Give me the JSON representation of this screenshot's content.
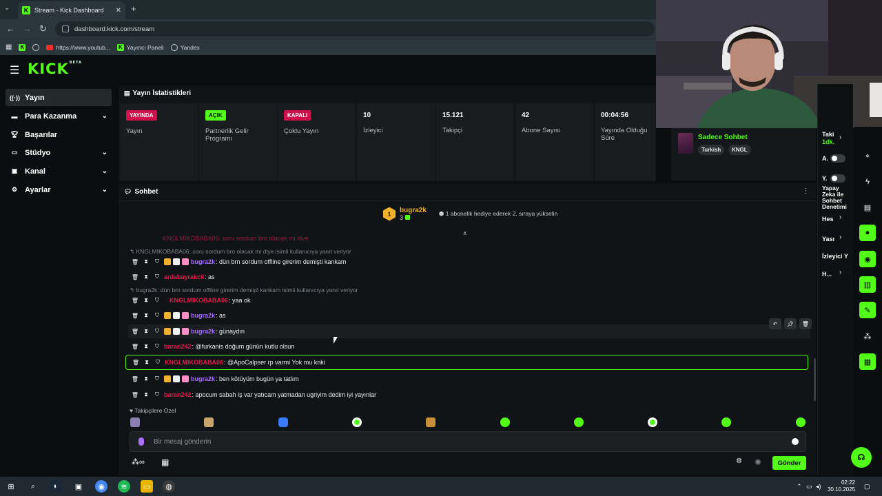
{
  "browser": {
    "tab_title": "Stream - Kick Dashboard",
    "url": "dashboard.kick.com/stream",
    "bookmarks": [
      "https://www.youtub...",
      "Yayıncı Paneli",
      "Yandex"
    ]
  },
  "logo": {
    "text": "KICK",
    "beta": "BETA"
  },
  "sidebar": {
    "items": [
      {
        "label": "Yayın",
        "icon": "broadcast-icon"
      },
      {
        "label": "Para Kazanma",
        "icon": "money-icon"
      },
      {
        "label": "Başarılar",
        "icon": "trophy-icon"
      },
      {
        "label": "Stüdyo",
        "icon": "studio-icon"
      },
      {
        "label": "Kanal",
        "icon": "channel-icon"
      },
      {
        "label": "Ayarlar",
        "icon": "gear-icon"
      }
    ]
  },
  "stats": {
    "title": "Yayın İstatistikleri",
    "cards": [
      {
        "badge": "YAYINDA",
        "label": "Yayın"
      },
      {
        "badge": "AÇIK",
        "label": "Partnerlik Gelir Programı"
      },
      {
        "badge": "KAPALI",
        "label": "Çoklu Yayın"
      },
      {
        "value": "10",
        "label": "İzleyici"
      },
      {
        "value": "15.121",
        "label": "Takipçi"
      },
      {
        "value": "42",
        "label": "Abone Sayısı"
      },
      {
        "value": "00:04:56",
        "label": "Yayında Olduğu Süre"
      }
    ]
  },
  "info": {
    "chat_mode": "Sadece Sohbet",
    "tags": [
      "Turkish",
      "KNGL"
    ]
  },
  "settings": {
    "rows": [
      "Taki",
      "1dk.",
      "A.",
      "Y.",
      "Yapay Zeka ile Sohbet Denetimi",
      "Hes",
      "Yası",
      "İzleyici Y",
      "H..."
    ]
  },
  "chat": {
    "title": "Sohbet",
    "pinned": {
      "rank": "1",
      "user": "bugra2k",
      "count": "3",
      "message": "1 abonelik hediye ederek 2. sıraya yükselin"
    },
    "top_partial": "KNGLMIKOBABA06: soru sordum bro olacak mi diye",
    "replies": [
      "KNGLMIKOBABA06: soru sordum bro olacak mi diye  isimli kullanıcıya yanıt veriyor",
      "bugra2k: dün brn sordum offline girerim demişti kankam isimli kullanıcıya yanıt veriyor"
    ],
    "messages": [
      {
        "user": "bugra2k",
        "text": ": dün brn sordum offline girerim demişti kankam"
      },
      {
        "user": "ardabayrakcil",
        "text": ": as"
      },
      {
        "user": "KNGLMIKOBABA06",
        "text": ": yaa ok"
      },
      {
        "user": "bugra2k",
        "text": ": as"
      },
      {
        "user": "bugra2k",
        "text": ": günaydın"
      },
      {
        "user": "baran242",
        "text": ": @furkanis doğum günün kutlu olsun"
      },
      {
        "user": "KNGLMIKOBABA06",
        "text": ": @ApoCalpser rp varmi Yok mu knki"
      },
      {
        "user": "bugra2k",
        "text": ": ben kötüyüm bugün ya tatlım"
      },
      {
        "user": "baran242",
        "text": ": apocum sabah iş var yatıcam yatmadan ugriyim dedim iyi yayınlar"
      }
    ],
    "followers_only": "Takipçilere Özel",
    "input_placeholder": "Bir mesaj gönderin",
    "send": "Gönder"
  },
  "taskbar": {
    "time": "02:22",
    "date": "30.10.2025"
  },
  "colors": {
    "accent": "#53fc18",
    "live": "#d0104d",
    "purple_name": "#a970ff",
    "red_name": "#e6194b"
  }
}
